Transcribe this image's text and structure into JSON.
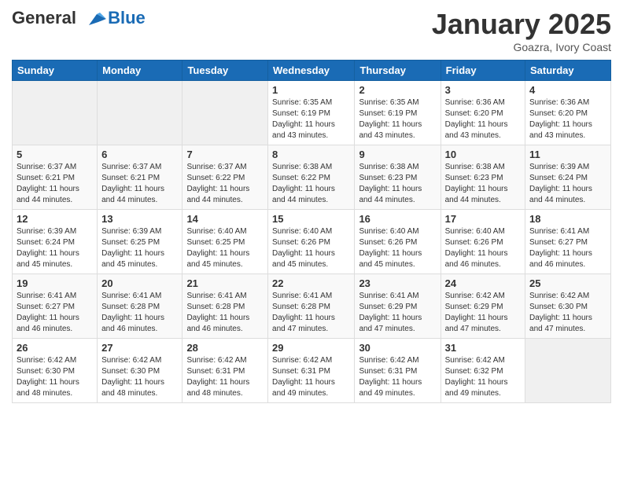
{
  "header": {
    "logo_line1": "General",
    "logo_line2": "Blue",
    "month_title": "January 2025",
    "location": "Goazra, Ivory Coast"
  },
  "days_of_week": [
    "Sunday",
    "Monday",
    "Tuesday",
    "Wednesday",
    "Thursday",
    "Friday",
    "Saturday"
  ],
  "weeks": [
    [
      {
        "day": "",
        "info": ""
      },
      {
        "day": "",
        "info": ""
      },
      {
        "day": "",
        "info": ""
      },
      {
        "day": "1",
        "info": "Sunrise: 6:35 AM\nSunset: 6:19 PM\nDaylight: 11 hours\nand 43 minutes."
      },
      {
        "day": "2",
        "info": "Sunrise: 6:35 AM\nSunset: 6:19 PM\nDaylight: 11 hours\nand 43 minutes."
      },
      {
        "day": "3",
        "info": "Sunrise: 6:36 AM\nSunset: 6:20 PM\nDaylight: 11 hours\nand 43 minutes."
      },
      {
        "day": "4",
        "info": "Sunrise: 6:36 AM\nSunset: 6:20 PM\nDaylight: 11 hours\nand 43 minutes."
      }
    ],
    [
      {
        "day": "5",
        "info": "Sunrise: 6:37 AM\nSunset: 6:21 PM\nDaylight: 11 hours\nand 44 minutes."
      },
      {
        "day": "6",
        "info": "Sunrise: 6:37 AM\nSunset: 6:21 PM\nDaylight: 11 hours\nand 44 minutes."
      },
      {
        "day": "7",
        "info": "Sunrise: 6:37 AM\nSunset: 6:22 PM\nDaylight: 11 hours\nand 44 minutes."
      },
      {
        "day": "8",
        "info": "Sunrise: 6:38 AM\nSunset: 6:22 PM\nDaylight: 11 hours\nand 44 minutes."
      },
      {
        "day": "9",
        "info": "Sunrise: 6:38 AM\nSunset: 6:23 PM\nDaylight: 11 hours\nand 44 minutes."
      },
      {
        "day": "10",
        "info": "Sunrise: 6:38 AM\nSunset: 6:23 PM\nDaylight: 11 hours\nand 44 minutes."
      },
      {
        "day": "11",
        "info": "Sunrise: 6:39 AM\nSunset: 6:24 PM\nDaylight: 11 hours\nand 44 minutes."
      }
    ],
    [
      {
        "day": "12",
        "info": "Sunrise: 6:39 AM\nSunset: 6:24 PM\nDaylight: 11 hours\nand 45 minutes."
      },
      {
        "day": "13",
        "info": "Sunrise: 6:39 AM\nSunset: 6:25 PM\nDaylight: 11 hours\nand 45 minutes."
      },
      {
        "day": "14",
        "info": "Sunrise: 6:40 AM\nSunset: 6:25 PM\nDaylight: 11 hours\nand 45 minutes."
      },
      {
        "day": "15",
        "info": "Sunrise: 6:40 AM\nSunset: 6:26 PM\nDaylight: 11 hours\nand 45 minutes."
      },
      {
        "day": "16",
        "info": "Sunrise: 6:40 AM\nSunset: 6:26 PM\nDaylight: 11 hours\nand 45 minutes."
      },
      {
        "day": "17",
        "info": "Sunrise: 6:40 AM\nSunset: 6:26 PM\nDaylight: 11 hours\nand 46 minutes."
      },
      {
        "day": "18",
        "info": "Sunrise: 6:41 AM\nSunset: 6:27 PM\nDaylight: 11 hours\nand 46 minutes."
      }
    ],
    [
      {
        "day": "19",
        "info": "Sunrise: 6:41 AM\nSunset: 6:27 PM\nDaylight: 11 hours\nand 46 minutes."
      },
      {
        "day": "20",
        "info": "Sunrise: 6:41 AM\nSunset: 6:28 PM\nDaylight: 11 hours\nand 46 minutes."
      },
      {
        "day": "21",
        "info": "Sunrise: 6:41 AM\nSunset: 6:28 PM\nDaylight: 11 hours\nand 46 minutes."
      },
      {
        "day": "22",
        "info": "Sunrise: 6:41 AM\nSunset: 6:28 PM\nDaylight: 11 hours\nand 47 minutes."
      },
      {
        "day": "23",
        "info": "Sunrise: 6:41 AM\nSunset: 6:29 PM\nDaylight: 11 hours\nand 47 minutes."
      },
      {
        "day": "24",
        "info": "Sunrise: 6:42 AM\nSunset: 6:29 PM\nDaylight: 11 hours\nand 47 minutes."
      },
      {
        "day": "25",
        "info": "Sunrise: 6:42 AM\nSunset: 6:30 PM\nDaylight: 11 hours\nand 47 minutes."
      }
    ],
    [
      {
        "day": "26",
        "info": "Sunrise: 6:42 AM\nSunset: 6:30 PM\nDaylight: 11 hours\nand 48 minutes."
      },
      {
        "day": "27",
        "info": "Sunrise: 6:42 AM\nSunset: 6:30 PM\nDaylight: 11 hours\nand 48 minutes."
      },
      {
        "day": "28",
        "info": "Sunrise: 6:42 AM\nSunset: 6:31 PM\nDaylight: 11 hours\nand 48 minutes."
      },
      {
        "day": "29",
        "info": "Sunrise: 6:42 AM\nSunset: 6:31 PM\nDaylight: 11 hours\nand 49 minutes."
      },
      {
        "day": "30",
        "info": "Sunrise: 6:42 AM\nSunset: 6:31 PM\nDaylight: 11 hours\nand 49 minutes."
      },
      {
        "day": "31",
        "info": "Sunrise: 6:42 AM\nSunset: 6:32 PM\nDaylight: 11 hours\nand 49 minutes."
      },
      {
        "day": "",
        "info": ""
      }
    ]
  ]
}
